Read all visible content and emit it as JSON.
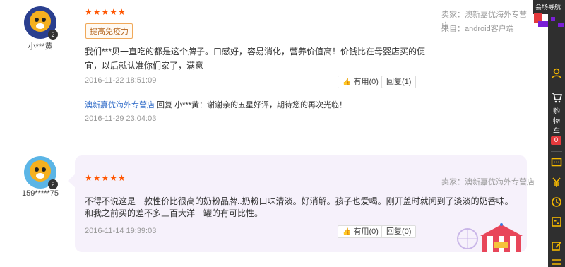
{
  "reviews": [
    {
      "username": "小***黄",
      "vip_badge": "2",
      "rating_stars": "★★★★★",
      "tag": "提高免疫力",
      "seller": "卖家：澳新嘉优海外专营店",
      "source": "来自：android客户端",
      "content": "我们***贝一直吃的都是这个牌子。口感好，容易消化，营养价值高！价钱比在母婴店买的便宜，以后就认准你们家了，满意",
      "date": "2016-11-22 18:51:09",
      "helpful_label": "有用(0)",
      "reply_label": "回复(1)",
      "seller_reply": {
        "store": "澳新嘉优海外专营店",
        "text": " 回复 小***黄：谢谢亲的五星好评，期待您的再次光临！",
        "date": "2016-11-29 23:04:03"
      }
    },
    {
      "username": "159*****75",
      "vip_badge": "2",
      "rating_stars": "★★★★★",
      "seller": "卖家：澳新嘉优海外专营店",
      "content": "不得不说这是一款性价比很高的奶粉品牌..奶粉口味清淡。好消解。孩子也爱喝。刚开盖时就闻到了淡淡的奶香味。和我之前买的差不多三百大洋一罐的有可比性。",
      "content_line1": "不得不说这是一款性价比很高的奶粉品牌..奶粉口味清淡。好消解。孩子也爱喝。刚开盖时就闻到了淡淡的奶香味。",
      "content_line2": "和我之前买的差不多三百大洋一罐的有可比性。",
      "date": "2016-11-14 19:39:03",
      "helpful_label": "有用(0)",
      "reply_label": "回复(0)"
    }
  ],
  "sidebar": {
    "venue_nav": "会场导航",
    "cart_label_chars": [
      "购",
      "物",
      "车"
    ],
    "cart_count": "0",
    "icons": [
      "user-icon",
      "cart-icon",
      "chat-icon",
      "coupon-icon",
      "history-icon",
      "qrcode-icon",
      "feedback-icon"
    ]
  },
  "colors": {
    "star": "#ff5500",
    "store_link": "#2866c6",
    "sidebar_bg": "#2f2f2f",
    "sidebar_icon": "#f5b800",
    "cart_badge": "#e4393c",
    "bubble_bg": "#f6f1fb"
  }
}
